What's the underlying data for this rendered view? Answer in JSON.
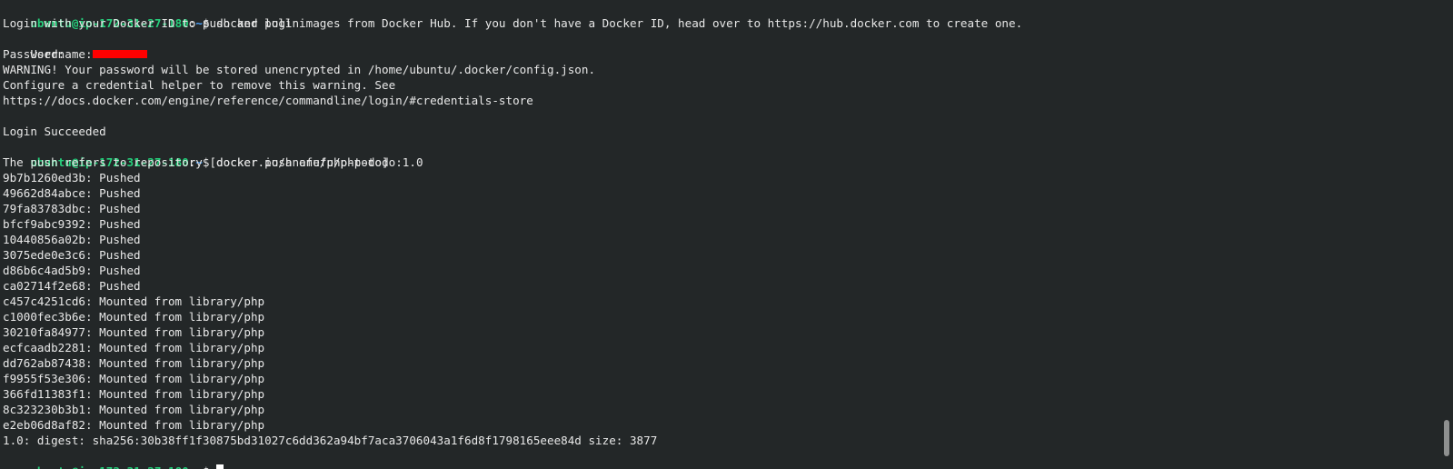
{
  "terminal": {
    "prompt": {
      "user_host": "ubuntu@ip-172-31-27-180",
      "sep": ":",
      "path": "~",
      "symbol": "$ "
    },
    "command_login": "docker login",
    "login_output": [
      "Login with your Docker ID to push and pull images from Docker Hub. If you don't have a Docker ID, head over to https://hub.docker.com to create one."
    ],
    "username_label": "Username:",
    "password_label": "Password:",
    "warning_lines": [
      "WARNING! Your password will be stored unencrypted in /home/ubuntu/.docker/config.json.",
      "Configure a credential helper to remove this warning. See",
      "https://docs.docker.com/engine/reference/commandline/login/#credentials-store"
    ],
    "login_result": "Login Succeeded",
    "command_push": "docker push anefu/php-todo:1.0",
    "push_header": "The push refers to repository [docker.io/anefu/php-todo]",
    "layers": [
      "9b7b1260ed3b: Pushed",
      "49662d84abce: Pushed",
      "79fa83783dbc: Pushed",
      "bfcf9abc9392: Pushed",
      "10440856a02b: Pushed",
      "3075ede0e3c6: Pushed",
      "d86b6c4ad5b9: Pushed",
      "ca02714f2e68: Pushed",
      "c457c4251cd6: Mounted from library/php",
      "c1000fec3b6e: Mounted from library/php",
      "30210fa84977: Mounted from library/php",
      "ecfcaadb2281: Mounted from library/php",
      "dd762ab87438: Mounted from library/php",
      "f9955f53e306: Mounted from library/php",
      "366fd11383f1: Mounted from library/php",
      "8c323230b3b1: Mounted from library/php",
      "e2eb06d8af82: Mounted from library/php"
    ],
    "digest_line": "1.0: digest: sha256:30b38ff1f30875bd31027c6dd362a94bf7aca3706043a1f6d8f1798165eee84d size: 3877"
  },
  "colors": {
    "background": "#232728",
    "prompt_user": "#26d07c",
    "prompt_path": "#4aa3ff",
    "text": "#e8e8e8",
    "redaction": "#ff0000"
  }
}
